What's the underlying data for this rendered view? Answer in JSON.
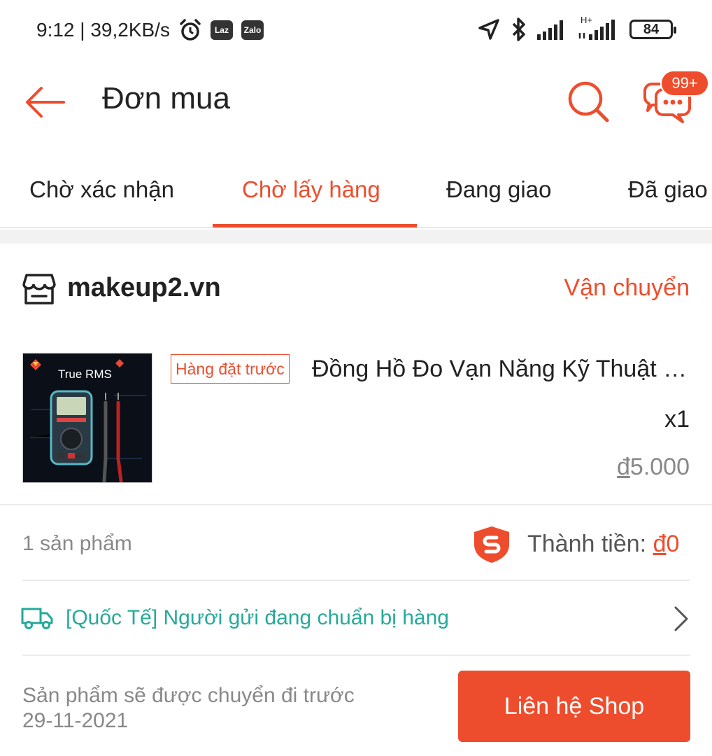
{
  "status_bar": {
    "time_speed": "9:12 | 39,2KB/s",
    "laz": "Laz",
    "zalo": "Zalo",
    "network": "H+",
    "battery": "84"
  },
  "header": {
    "title": "Đơn mua",
    "chat_badge": "99+"
  },
  "tabs": [
    {
      "label": "Chờ xác nhận",
      "active": false
    },
    {
      "label": "Chờ lấy hàng",
      "active": true
    },
    {
      "label": "Đang giao",
      "active": false
    },
    {
      "label": "Đã giao",
      "active": false
    }
  ],
  "order": {
    "shop_name": "makeup2.vn",
    "shop_status": "Vận chuyển",
    "product": {
      "tag": "Hàng đặt trước",
      "name": "Đồng Hồ Đo Vạn Năng Kỹ Thuật Số True RMS",
      "thumb_caption": "True RMS",
      "quantity": "x1",
      "price_symbol": "đ",
      "price": "5.000"
    },
    "item_count": "1 sản phẩm",
    "total_label": "Thành tiền: ",
    "total_symbol": "đ",
    "total_value": "0",
    "shipping_status": "[Quốc Tế] Người gửi đang chuẩn bị hàng",
    "ship_note_line1": "Sản phẩm sẽ được chuyển đi trước",
    "ship_note_line2": "29-11-2021",
    "contact_button": "Liên hệ Shop"
  },
  "colors": {
    "accent": "#ee4d2d",
    "teal": "#26aa99",
    "muted": "#888888"
  }
}
